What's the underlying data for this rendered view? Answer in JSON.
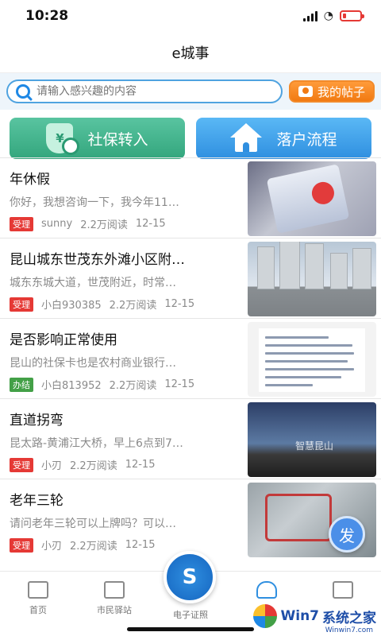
{
  "status_bar": {
    "time": "10:28",
    "battery_level": 0.2,
    "battery_color": "#e53935"
  },
  "nav": {
    "title": "e城事"
  },
  "search": {
    "placeholder": "请输入感兴趣的内容",
    "my_posts_label": "我的帖子"
  },
  "quick_actions": [
    {
      "label": "社保转入",
      "icon": "shield-yuan-icon",
      "color": "#33a67d"
    },
    {
      "label": "落户流程",
      "icon": "house-icon",
      "color": "#2f8fe0"
    }
  ],
  "feed": [
    {
      "title": "年休假",
      "summary": "你好，我想咨询一下，我今年11…",
      "status": "受理",
      "author": "sunny",
      "reads": "2.2万阅读",
      "date": "12-15",
      "thumb": "card-photo"
    },
    {
      "title": "昆山城东世茂东外滩小区附…",
      "summary": "城东东城大道，世茂附近，时常…",
      "status": "受理",
      "author": "小白930385",
      "reads": "2.2万阅读",
      "date": "12-15",
      "thumb": "buildings-photo"
    },
    {
      "title": "是否影响正常使用",
      "summary": "昆山的社保卡也是农村商业银行…",
      "status": "办结",
      "author": "小白813952",
      "reads": "2.2万阅读",
      "date": "12-15",
      "thumb": "document-photo"
    },
    {
      "title": "直道拐弯",
      "summary": "昆太路-黄浦江大桥，早上6点到7…",
      "status": "受理",
      "author": "小刃",
      "reads": "2.2万阅读",
      "date": "12-15",
      "thumb": "night-road-photo",
      "thumb_watermark": "智慧昆山"
    },
    {
      "title": "老年三轮",
      "summary": "请问老年三轮可以上牌吗？可以…",
      "status": "受理",
      "author": "小刃",
      "reads": "2.2万阅读",
      "date": "12-15",
      "thumb": "tricycle-photo"
    }
  ],
  "fab": {
    "label": "发"
  },
  "tabs": [
    {
      "label": "首页",
      "icon": "home-tab-icon"
    },
    {
      "label": "市民驿站",
      "icon": "station-tab-icon"
    },
    {
      "label": "电子证照",
      "icon": "license-tab-icon"
    },
    {
      "label": "",
      "icon": "city-tab-icon"
    },
    {
      "label": "",
      "icon": "profile-tab-icon"
    }
  ],
  "watermark": {
    "text": "系统之家",
    "brand": "Win7",
    "url": "Winwin7.com"
  }
}
